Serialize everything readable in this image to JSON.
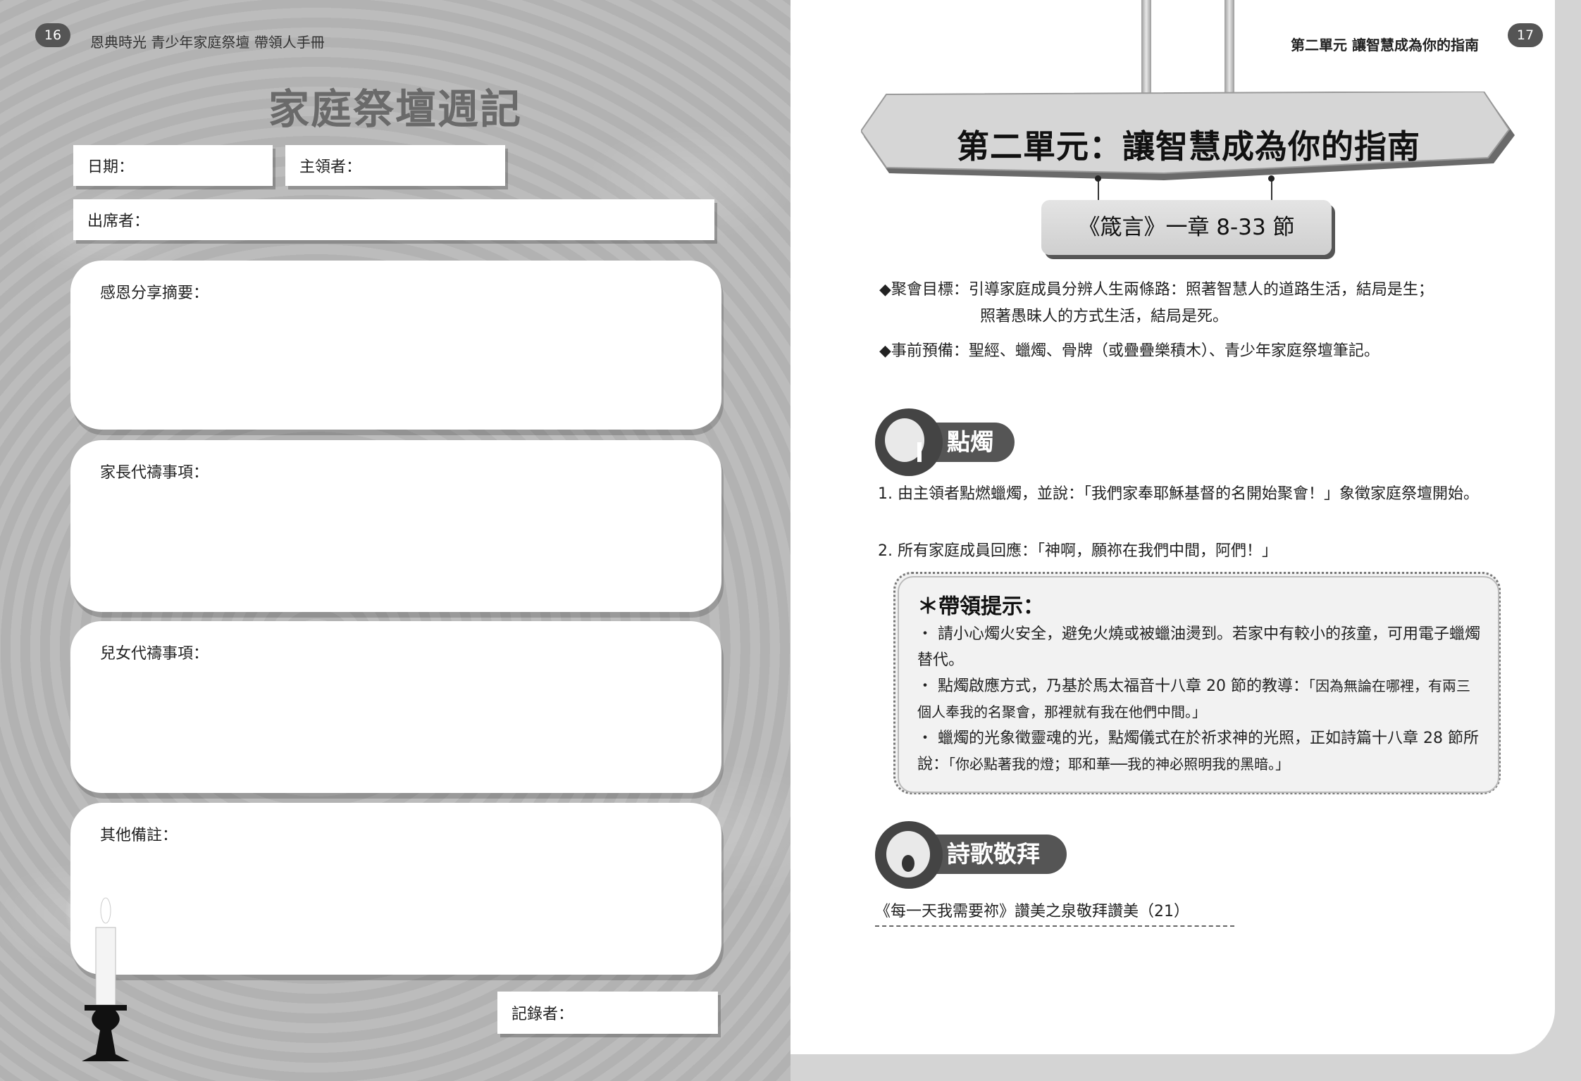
{
  "left_page": {
    "page_number": "16",
    "running_head": "恩典時光  青少年家庭祭壇 帶領人手冊",
    "title": "家庭祭壇週記",
    "fields": {
      "date": "日期：",
      "leader": "主領者：",
      "attendees": "出席者：",
      "recorder": "記錄者："
    },
    "boxes": {
      "thanks": "感恩分享摘要：",
      "parent_prayer": "家長代禱事項：",
      "children_prayer": "兒女代禱事項：",
      "notes": "其他備註："
    }
  },
  "right_page": {
    "page_number": "17",
    "running_head": "第二單元  讓智慧成為你的指南",
    "unit_title": "第二單元：讓智慧成為你的指南",
    "scripture": "《箴言》一章 8-33 節",
    "goal_line1": "◆聚會目標：引導家庭成員分辨人生兩條路：照著智慧人的道路生活，結局是生；",
    "goal_line2": "照著愚昧人的方式生活，結局是死。",
    "prep": "◆事前預備：聖經、蠟燭、骨牌（或疊疊樂積木）、青少年家庭祭壇筆記。",
    "section_candle": "點燭",
    "steps": [
      "1. 由主領者點燃蠟燭，並說：「我們家奉耶穌基督的名開始聚會！」象徵家庭祭壇開始。",
      "2. 所有家庭成員回應：「神啊，願祢在我們中間，阿們！」"
    ],
    "tips_title": "＊帶領提示：",
    "tips": {
      "t1": "・ 請小心燭火安全，避免火燒或被蠟油燙到。若家中有較小的孩童，可用電子蠟燭替代。",
      "t2a": "・ 點燭啟應方式，乃基於馬太福音十八章 20 節的教導：",
      "t2b": "「因為無論在哪裡，有兩三個人奉我的名聚會，那裡就有我在他們中間。」",
      "t3a": "・ 蠟燭的光象徵靈魂的光，點燭儀式在於祈求神的光照，正如詩篇十八章 28 節所說：",
      "t3b": "「你必點著我的燈；耶和華──我的神必照明我的黑暗。」"
    },
    "section_worship": "詩歌敬拜",
    "song": "《每一天我需要祢》讚美之泉敬拜讚美（21）"
  }
}
